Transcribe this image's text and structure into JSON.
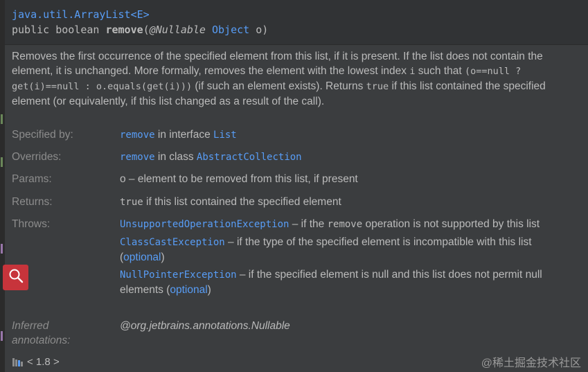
{
  "header": {
    "class_name": "java.util.ArrayList<E>",
    "sig_prefix": "public boolean ",
    "sig_method": "remove",
    "sig_paren_open": "(",
    "sig_annotation": "@Nullable",
    "sig_space": " ",
    "sig_param_type": "Object",
    "sig_param_rest": " o)"
  },
  "description": {
    "t1": "Removes the first occurrence of the specified element from this list, if it is present. If the list does not contain the element, it is unchanged. More formally, removes the element with the lowest index ",
    "code_i": "i",
    "t2": " such that ",
    "code_expr": "(o==null ? get(i)==null : o.equals(get(i)))",
    "t3": " (if such an element exists). Returns ",
    "code_true": "true",
    "t4": " if this list contained the specified element (or equivalently, if this list changed as a result of the call)."
  },
  "specified_by": {
    "label": "Specified by:",
    "method_link": "remove",
    "middle": " in interface ",
    "type_link": "List"
  },
  "overrides": {
    "label": "Overrides:",
    "method_link": "remove",
    "middle": " in class ",
    "type_link": "AbstractCollection"
  },
  "params": {
    "label": "Params:",
    "text": "o – element to be removed from this list, if present"
  },
  "returns": {
    "label": "Returns:",
    "code": "true",
    "text": " if this list contained the specified element"
  },
  "throws": {
    "label": "Throws:",
    "items": [
      {
        "link": "UnsupportedOperationException",
        "t1": " – if the ",
        "code": "remove",
        "t2": " operation is not supported by this list"
      },
      {
        "link": "ClassCastException",
        "t1": " – if the type of the specified element is incompatible with this list (",
        "opt": "optional",
        "t2": ")"
      },
      {
        "link": "NullPointerException",
        "t1": " – if the specified element is null and this list does not permit null elements (",
        "opt": "optional",
        "t2": ")"
      }
    ]
  },
  "inferred": {
    "label": "Inferred annotations:",
    "value": "@org.jetbrains.annotations.Nullable"
  },
  "footer": {
    "version": "< 1.8 >"
  },
  "watermark": "@稀土掘金技术社区",
  "colors": {
    "background": "#3b3d3f",
    "header_background": "#313335",
    "link": "#589df6",
    "text": "#bbbbbb",
    "label": "#8c8c8c",
    "search_button": "#c7343b"
  },
  "icons": {
    "search": "search-icon",
    "library": "library-icon"
  }
}
